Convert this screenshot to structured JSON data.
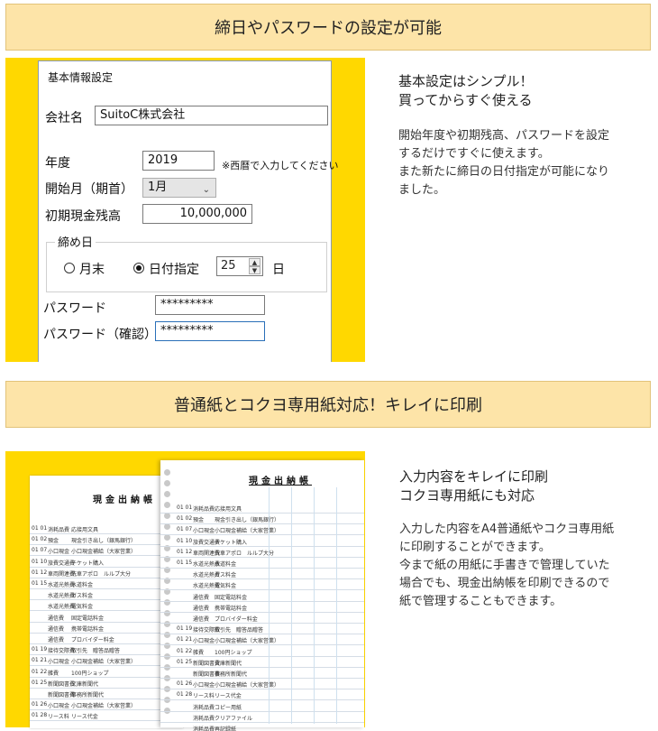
{
  "section1": {
    "banner": "締日やパスワードの設定が可能",
    "window": {
      "title": "基本情報設定",
      "company_label": "会社名",
      "company_value": "SuitoC株式会社",
      "year_label": "年度",
      "year_value": "2019",
      "year_hint": "※西暦で入力してください",
      "start_month_label": "開始月（期首）",
      "start_month_value": "1月",
      "opening_cash_label": "初期現金残高",
      "opening_cash_value": "10,000,000",
      "closing_group_label": "締め日",
      "radio_month_end": "月末",
      "radio_date": "日付指定",
      "radio_selected": "日付指定",
      "closing_day_value": "25",
      "day_unit": "日",
      "password_label": "パスワード",
      "password_value": "*********",
      "password_confirm_label": "パスワード（確認）",
      "password_confirm_value": "*********"
    },
    "heading_line1": "基本設定はシンプル！",
    "heading_line2": "買ってからすぐ使える",
    "body": [
      "開始年度や初期残高、パスワードを設定",
      "するだけですぐに使えます。",
      "また新たに締日の日付指定が可能になり",
      "ました。"
    ]
  },
  "section2": {
    "banner": "普通紙とコクヨ専用紙対応！キレイに印刷",
    "ledger_title": "現金出納帳",
    "ledger_rows": [
      {
        "d": "01 01",
        "item": "消耗品費",
        "memo": "応接用文具"
      },
      {
        "d": "01 02",
        "item": "預金",
        "memo": "現金引き出し（銀馬銀行）"
      },
      {
        "d": "01 07",
        "item": "小口現金",
        "memo": "小口現金補給（大家営業）"
      },
      {
        "d": "01 10",
        "item": "旅費交通費",
        "memo": "チケット購入"
      },
      {
        "d": "01 12",
        "item": "車両関連費",
        "memo": "洗車アポロ　ルルプ大分"
      },
      {
        "d": "01 15",
        "item": "水道光熱費",
        "memo": "水道料金"
      },
      {
        "d": "",
        "item": "水道光熱費",
        "memo": "ガス料金"
      },
      {
        "d": "",
        "item": "水道光熱費",
        "memo": "電気料金"
      },
      {
        "d": "",
        "item": "通信費",
        "memo": "固定電話料金"
      },
      {
        "d": "",
        "item": "通信費",
        "memo": "携帯電話料金"
      },
      {
        "d": "",
        "item": "通信費",
        "memo": "プロバイダー料金"
      },
      {
        "d": "01 19",
        "item": "接待交際費",
        "memo": "取引先　贈答品贈答"
      },
      {
        "d": "01 21",
        "item": "小口現金",
        "memo": "小口現金補給（大家営業）"
      },
      {
        "d": "01 22",
        "item": "雑費",
        "memo": "100円ショップ"
      },
      {
        "d": "01 25",
        "item": "新聞図書費",
        "memo": "文庫新聞代"
      },
      {
        "d": "",
        "item": "新聞図書費",
        "memo": "事務所新聞代"
      },
      {
        "d": "01 26",
        "item": "小口現金",
        "memo": "小口現金補給（大家営業）"
      },
      {
        "d": "01 28",
        "item": "リース料",
        "memo": "リース代金"
      },
      {
        "d": "",
        "item": "消耗品費",
        "memo": "コピー用紙"
      },
      {
        "d": "",
        "item": "消耗品費",
        "memo": "クリアファイル"
      },
      {
        "d": "",
        "item": "消耗品費",
        "memo": "再記録紙"
      }
    ],
    "heading_line1": "入力内容をキレイに印刷",
    "heading_line2": "コクヨ専用紙にも対応",
    "body": [
      "入力した内容をA4普通紙やコクヨ専用紙",
      "に印刷することができます。",
      "今まで紙の用紙に手書きで管理していた",
      "場合でも、現金出納帳を印刷できるので",
      "紙で管理することもできます。"
    ]
  }
}
